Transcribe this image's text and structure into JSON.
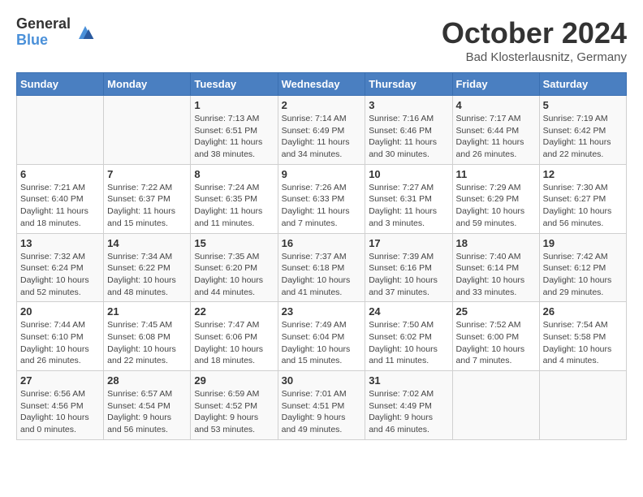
{
  "header": {
    "logo": {
      "general": "General",
      "blue": "Blue"
    },
    "title": "October 2024",
    "subtitle": "Bad Klosterlausnitz, Germany"
  },
  "days_of_week": [
    "Sunday",
    "Monday",
    "Tuesday",
    "Wednesday",
    "Thursday",
    "Friday",
    "Saturday"
  ],
  "weeks": [
    [
      {
        "day": "",
        "info": ""
      },
      {
        "day": "",
        "info": ""
      },
      {
        "day": "1",
        "info": "Sunrise: 7:13 AM\nSunset: 6:51 PM\nDaylight: 11 hours and 38 minutes."
      },
      {
        "day": "2",
        "info": "Sunrise: 7:14 AM\nSunset: 6:49 PM\nDaylight: 11 hours and 34 minutes."
      },
      {
        "day": "3",
        "info": "Sunrise: 7:16 AM\nSunset: 6:46 PM\nDaylight: 11 hours and 30 minutes."
      },
      {
        "day": "4",
        "info": "Sunrise: 7:17 AM\nSunset: 6:44 PM\nDaylight: 11 hours and 26 minutes."
      },
      {
        "day": "5",
        "info": "Sunrise: 7:19 AM\nSunset: 6:42 PM\nDaylight: 11 hours and 22 minutes."
      }
    ],
    [
      {
        "day": "6",
        "info": "Sunrise: 7:21 AM\nSunset: 6:40 PM\nDaylight: 11 hours and 18 minutes."
      },
      {
        "day": "7",
        "info": "Sunrise: 7:22 AM\nSunset: 6:37 PM\nDaylight: 11 hours and 15 minutes."
      },
      {
        "day": "8",
        "info": "Sunrise: 7:24 AM\nSunset: 6:35 PM\nDaylight: 11 hours and 11 minutes."
      },
      {
        "day": "9",
        "info": "Sunrise: 7:26 AM\nSunset: 6:33 PM\nDaylight: 11 hours and 7 minutes."
      },
      {
        "day": "10",
        "info": "Sunrise: 7:27 AM\nSunset: 6:31 PM\nDaylight: 11 hours and 3 minutes."
      },
      {
        "day": "11",
        "info": "Sunrise: 7:29 AM\nSunset: 6:29 PM\nDaylight: 10 hours and 59 minutes."
      },
      {
        "day": "12",
        "info": "Sunrise: 7:30 AM\nSunset: 6:27 PM\nDaylight: 10 hours and 56 minutes."
      }
    ],
    [
      {
        "day": "13",
        "info": "Sunrise: 7:32 AM\nSunset: 6:24 PM\nDaylight: 10 hours and 52 minutes."
      },
      {
        "day": "14",
        "info": "Sunrise: 7:34 AM\nSunset: 6:22 PM\nDaylight: 10 hours and 48 minutes."
      },
      {
        "day": "15",
        "info": "Sunrise: 7:35 AM\nSunset: 6:20 PM\nDaylight: 10 hours and 44 minutes."
      },
      {
        "day": "16",
        "info": "Sunrise: 7:37 AM\nSunset: 6:18 PM\nDaylight: 10 hours and 41 minutes."
      },
      {
        "day": "17",
        "info": "Sunrise: 7:39 AM\nSunset: 6:16 PM\nDaylight: 10 hours and 37 minutes."
      },
      {
        "day": "18",
        "info": "Sunrise: 7:40 AM\nSunset: 6:14 PM\nDaylight: 10 hours and 33 minutes."
      },
      {
        "day": "19",
        "info": "Sunrise: 7:42 AM\nSunset: 6:12 PM\nDaylight: 10 hours and 29 minutes."
      }
    ],
    [
      {
        "day": "20",
        "info": "Sunrise: 7:44 AM\nSunset: 6:10 PM\nDaylight: 10 hours and 26 minutes."
      },
      {
        "day": "21",
        "info": "Sunrise: 7:45 AM\nSunset: 6:08 PM\nDaylight: 10 hours and 22 minutes."
      },
      {
        "day": "22",
        "info": "Sunrise: 7:47 AM\nSunset: 6:06 PM\nDaylight: 10 hours and 18 minutes."
      },
      {
        "day": "23",
        "info": "Sunrise: 7:49 AM\nSunset: 6:04 PM\nDaylight: 10 hours and 15 minutes."
      },
      {
        "day": "24",
        "info": "Sunrise: 7:50 AM\nSunset: 6:02 PM\nDaylight: 10 hours and 11 minutes."
      },
      {
        "day": "25",
        "info": "Sunrise: 7:52 AM\nSunset: 6:00 PM\nDaylight: 10 hours and 7 minutes."
      },
      {
        "day": "26",
        "info": "Sunrise: 7:54 AM\nSunset: 5:58 PM\nDaylight: 10 hours and 4 minutes."
      }
    ],
    [
      {
        "day": "27",
        "info": "Sunrise: 6:56 AM\nSunset: 4:56 PM\nDaylight: 10 hours and 0 minutes."
      },
      {
        "day": "28",
        "info": "Sunrise: 6:57 AM\nSunset: 4:54 PM\nDaylight: 9 hours and 56 minutes."
      },
      {
        "day": "29",
        "info": "Sunrise: 6:59 AM\nSunset: 4:52 PM\nDaylight: 9 hours and 53 minutes."
      },
      {
        "day": "30",
        "info": "Sunrise: 7:01 AM\nSunset: 4:51 PM\nDaylight: 9 hours and 49 minutes."
      },
      {
        "day": "31",
        "info": "Sunrise: 7:02 AM\nSunset: 4:49 PM\nDaylight: 9 hours and 46 minutes."
      },
      {
        "day": "",
        "info": ""
      },
      {
        "day": "",
        "info": ""
      }
    ]
  ]
}
